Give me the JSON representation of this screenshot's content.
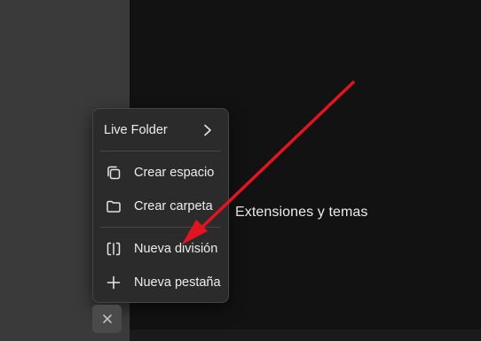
{
  "menu": {
    "live_folder": "Live Folder",
    "create_space": "Crear espacio",
    "create_folder": "Crear carpeta",
    "new_split": "Nueva división",
    "new_tab": "Nueva pestaña"
  },
  "content": {
    "text": "Extensiones y temas"
  },
  "colors": {
    "annotation_arrow": "#e0151f",
    "menu_bg": "#2b2b2b",
    "content_bg": "#121212",
    "sidebar_bg": "#3a3a3a"
  },
  "icons": [
    "chevron-right-icon",
    "copy-icon",
    "folder-icon",
    "split-view-icon",
    "plus-icon",
    "close-icon"
  ]
}
